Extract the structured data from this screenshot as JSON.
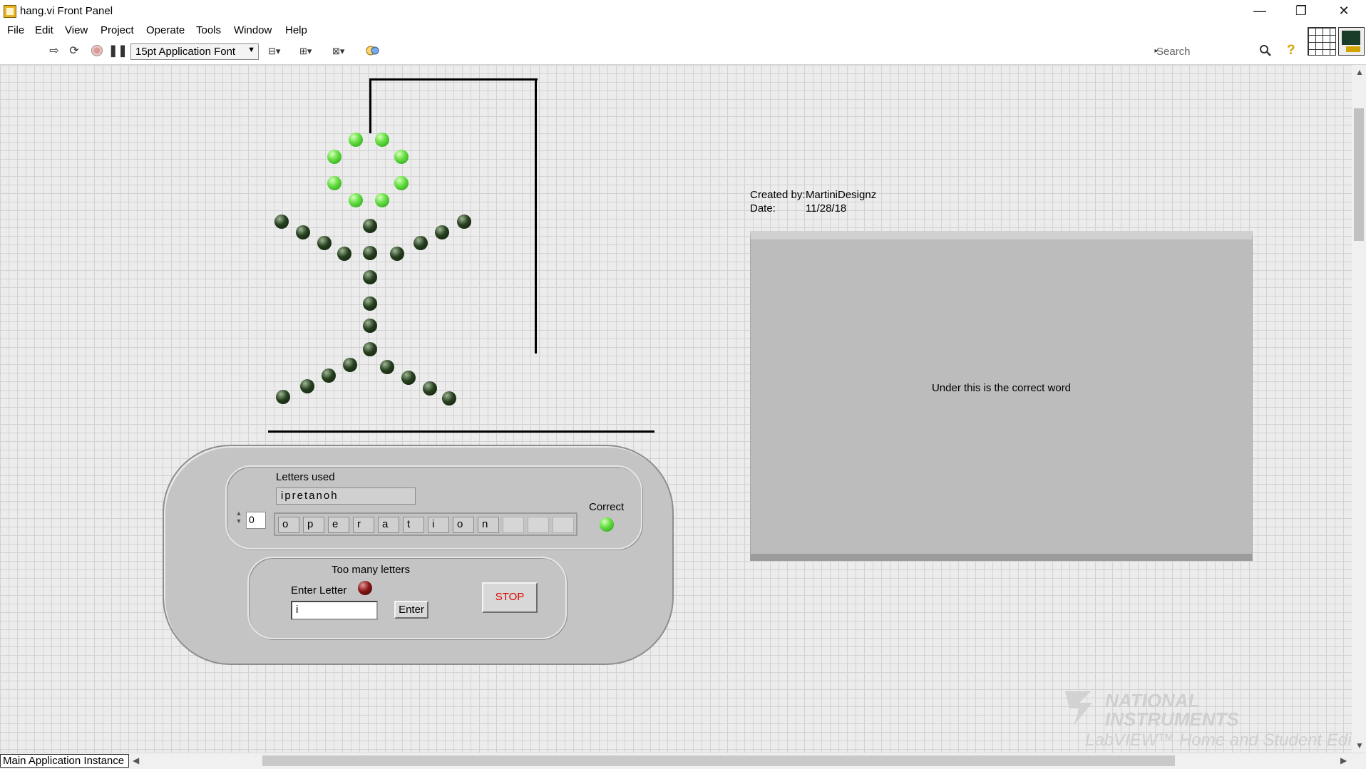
{
  "window": {
    "title": "hang.vi Front Panel",
    "min_glyph": "—",
    "max_glyph": "❐",
    "close_glyph": "✕"
  },
  "menu": [
    "File",
    "Edit",
    "View",
    "Project",
    "Operate",
    "Tools",
    "Window",
    "Help"
  ],
  "toolbar": {
    "font": "15pt Application Font",
    "search_placeholder": "Search",
    "help_glyph": "?"
  },
  "panel": {
    "created_by_label": "Created by:",
    "created_by": "MartiniDesignz",
    "date_label": "Date:",
    "date": "11/28/18",
    "word_hint": "Under this is the correct word",
    "letters_used_label": "Letters used",
    "letters_used": "ipretanoh",
    "array_index": "0",
    "word_letters": [
      "o",
      "p",
      "e",
      "r",
      "a",
      "t",
      "i",
      "o",
      "n",
      "",
      "",
      ""
    ],
    "correct_label": "Correct",
    "too_many_label": "Too many letters",
    "enter_letter_label": "Enter Letter",
    "enter_letter_value": "i",
    "enter_button": "Enter",
    "stop_button": "STOP"
  },
  "watermark": {
    "line1": "NATIONAL",
    "line2": "INSTRUMENTS",
    "edition": "LabVIEW™ Home and Student Edition"
  },
  "statusbar": {
    "instance": "Main Application Instance"
  },
  "colors": {
    "led_on": "#6ae046",
    "led_off": "#26401f",
    "led_red": "#8a1616",
    "stop_text": "#e00000"
  }
}
